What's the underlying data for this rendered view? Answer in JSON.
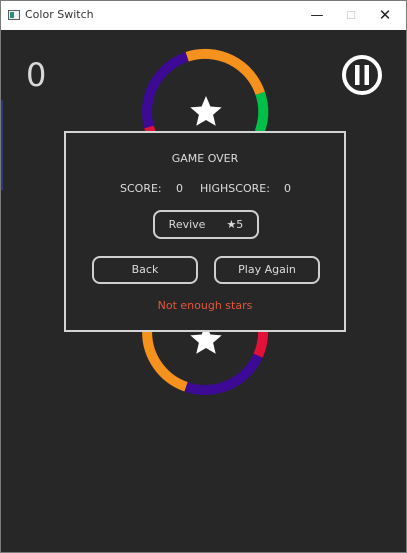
{
  "window": {
    "title": "Color Switch",
    "app_icon": "app-icon",
    "controls": {
      "minimize": "—",
      "maximize": "☐",
      "close": "✕"
    }
  },
  "hud": {
    "score": "0",
    "pause_icon": "pause-icon"
  },
  "game_over": {
    "title": "GAME OVER",
    "score_label": "SCORE:",
    "score_value": "0",
    "highscore_label": "HIGHSCORE:",
    "highscore_value": "0",
    "revive_label": "Revive",
    "revive_cost": "★5",
    "back_label": "Back",
    "play_again_label": "Play Again",
    "message": "Not enough stars"
  },
  "colors": {
    "background": "#272727",
    "orange": "#F5921E",
    "green": "#00C04A",
    "purple": "#3C0A94",
    "red": "#E3103A",
    "message": "#E0573A",
    "text": "#DCDCDC"
  }
}
